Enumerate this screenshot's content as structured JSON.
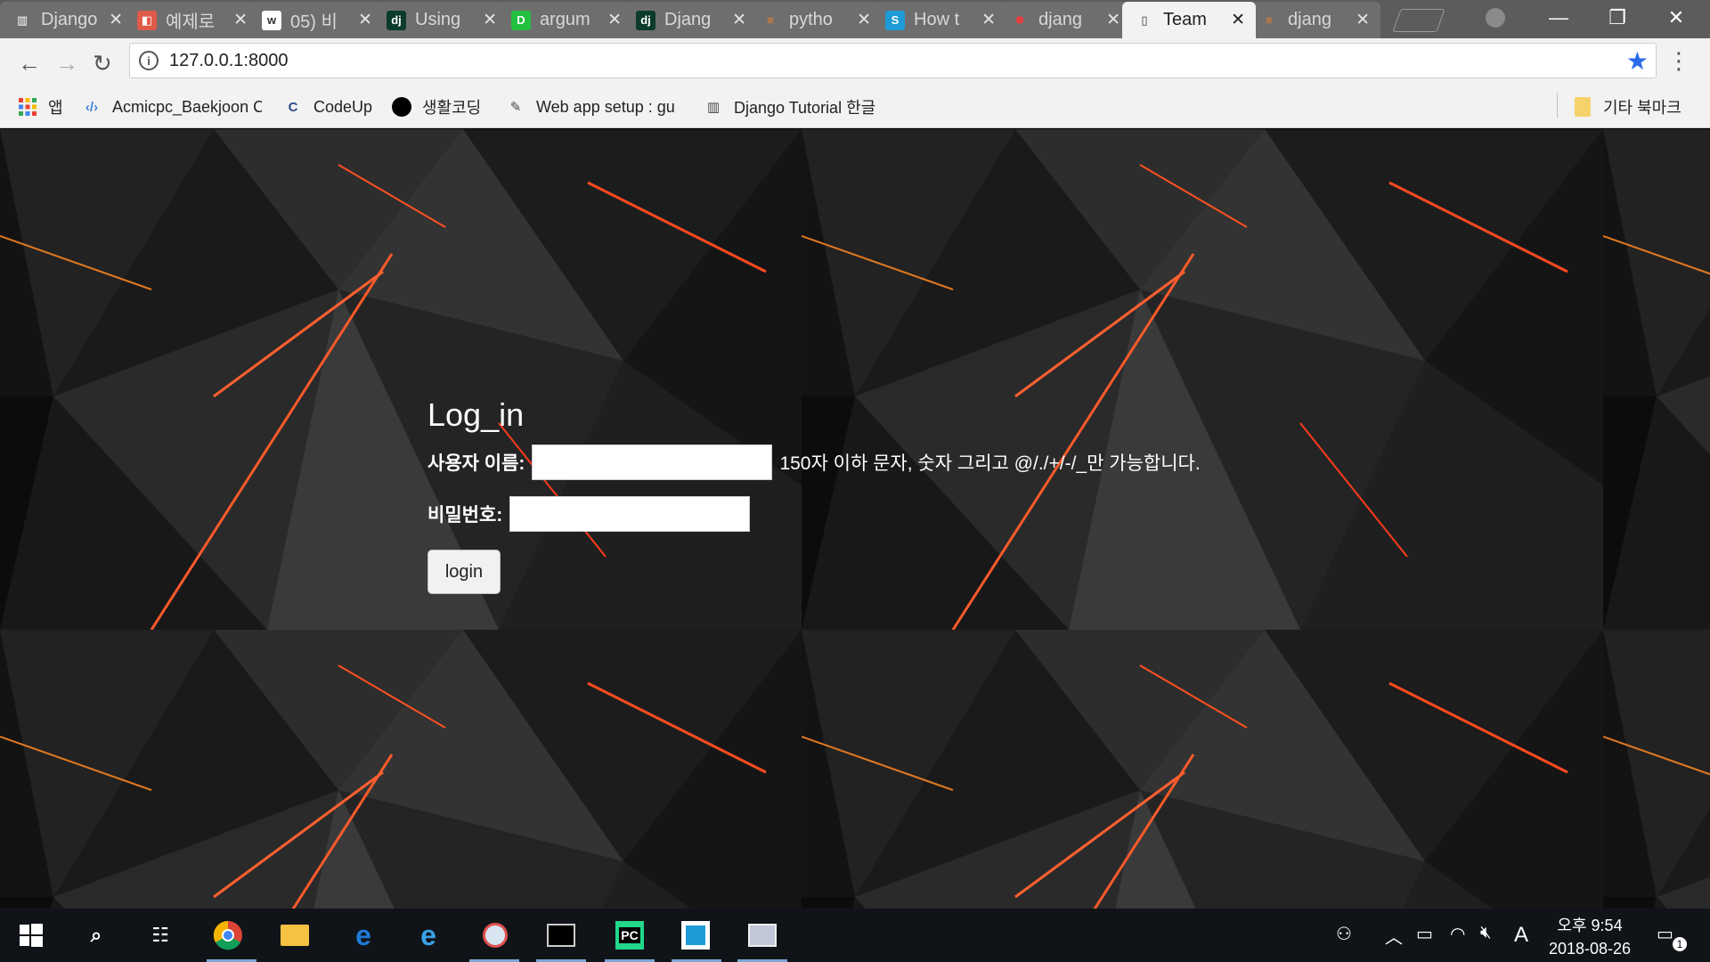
{
  "browser": {
    "tabs": [
      {
        "title": "Django",
        "icon": "book-icon",
        "color": "#6e6e6e"
      },
      {
        "title": "예제로",
        "icon": "site-icon",
        "color": "#e05a4a"
      },
      {
        "title": "05) 비",
        "icon": "wikidocs-icon",
        "color": "#ffffff"
      },
      {
        "title": "Using",
        "icon": "dj-icon",
        "color": "#0c3b2e"
      },
      {
        "title": "argum",
        "icon": "dict-icon",
        "color": "#22c040"
      },
      {
        "title": "Djang",
        "icon": "dj-icon",
        "color": "#0c3b2e"
      },
      {
        "title": "pytho",
        "icon": "stackoverflow-icon",
        "color": "#f48024"
      },
      {
        "title": "How t",
        "icon": "s-icon",
        "color": "#1e9bd7"
      },
      {
        "title": "djang",
        "icon": "circle-icon",
        "color": "#e04040"
      },
      {
        "title": "Team",
        "icon": "page-icon",
        "color": "#f2f2f2",
        "active": true
      },
      {
        "title": "djang",
        "icon": "stackoverflow-icon",
        "color": "#f48024"
      }
    ],
    "close_glyph": "✕",
    "url": "127.0.0.1:8000"
  },
  "bookmarks": {
    "apps_label": "앱",
    "items": [
      {
        "label": "Acmicpc_Baekjoon C",
        "icon": "code-icon"
      },
      {
        "label": "CodeUp",
        "icon": "codeup-icon"
      },
      {
        "label": "생활코딩",
        "icon": "black-circle-icon"
      },
      {
        "label": "Web app setup : gu",
        "icon": "pen-icon"
      },
      {
        "label": "Django Tutorial 한글",
        "icon": "book-icon"
      }
    ],
    "other_label": "기타 북마크"
  },
  "login_form": {
    "heading": "Log_in",
    "username_label": "사용자 이름:",
    "username_help": "150자 이하 문자, 숫자 그리고 @/./+/-/_만 가능합니다.",
    "password_label": "비밀번호:",
    "submit_label": "login"
  },
  "taskbar": {
    "time": "오후 9:54",
    "date": "2018-08-26",
    "input_indicator": "A",
    "notification_count": "1"
  }
}
